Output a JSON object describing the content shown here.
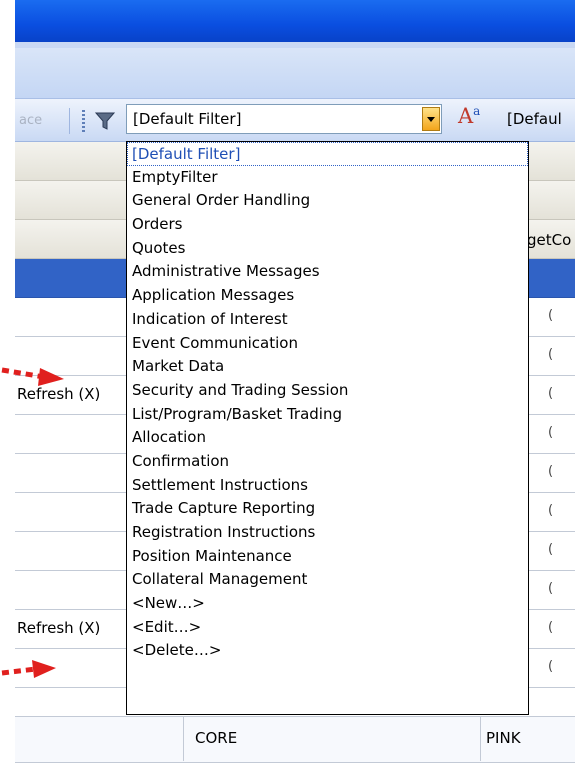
{
  "toolbar": {
    "clipped_label": "ace",
    "filter_combo_value": "[Default Filter]",
    "font_combo_value": "[Defaul"
  },
  "grid": {
    "header_partial": "getCo",
    "rows": [
      {
        "col1": "",
        "right": ""
      },
      {
        "col1": "",
        "right": "("
      },
      {
        "col1": "Refresh (X)",
        "right": "("
      },
      {
        "col1": "",
        "right": "("
      },
      {
        "col1": "",
        "right": "("
      },
      {
        "col1": "",
        "right": "("
      },
      {
        "col1": "",
        "right": "("
      },
      {
        "col1": "Refresh (X)",
        "right": "("
      },
      {
        "col1": "",
        "right": "("
      }
    ],
    "footer": {
      "col2": "CORE",
      "col3": "PINK"
    }
  },
  "dropdown": {
    "items": [
      "[Default Filter]",
      "EmptyFilter",
      "General Order Handling",
      "Orders",
      "Quotes",
      "Administrative Messages",
      "Application Messages",
      "Indication of Interest",
      "Event Communication",
      "Market Data",
      "Security and Trading Session",
      "List/Program/Basket Trading",
      "Allocation",
      "Confirmation",
      "Settlement Instructions",
      "Trade Capture Reporting",
      "Registration Instructions",
      "Position Maintenance",
      "Collateral Management",
      "<New…>",
      "<Edit…>",
      "<Delete…>"
    ]
  },
  "colors": {
    "title_blue": "#0a4ee0",
    "selection_blue": "#3163c6",
    "annotation_red": "#e0201e"
  },
  "icons": [
    "filter-icon",
    "font-icon",
    "dropdown-arrow-icon",
    "red-arrow-icon"
  ]
}
